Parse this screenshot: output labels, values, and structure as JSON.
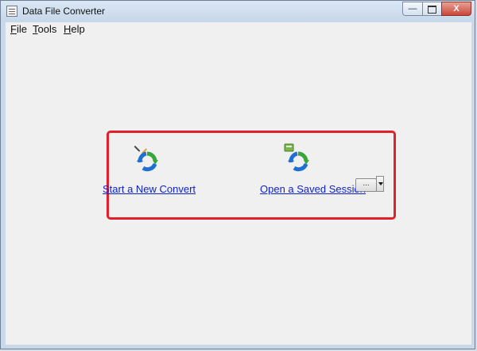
{
  "window": {
    "title": "Data File Converter",
    "close_glyph": "X",
    "minimize_glyph": "—"
  },
  "menu": {
    "file": "F",
    "file_rest": "ile",
    "tools": "T",
    "tools_rest": "ools",
    "help": "H",
    "help_rest": "elp"
  },
  "actions": {
    "new_convert": {
      "label": "Start a New Convert",
      "icon": "convert-pencil-icon"
    },
    "open_session": {
      "label": "Open a Saved Session",
      "icon": "convert-folder-icon"
    },
    "browse_label": "..."
  },
  "colors": {
    "link": "#0b1fd6",
    "highlight": "#e0202a",
    "arrow_blue": "#1e6fd0",
    "arrow_green": "#3aa53a"
  }
}
